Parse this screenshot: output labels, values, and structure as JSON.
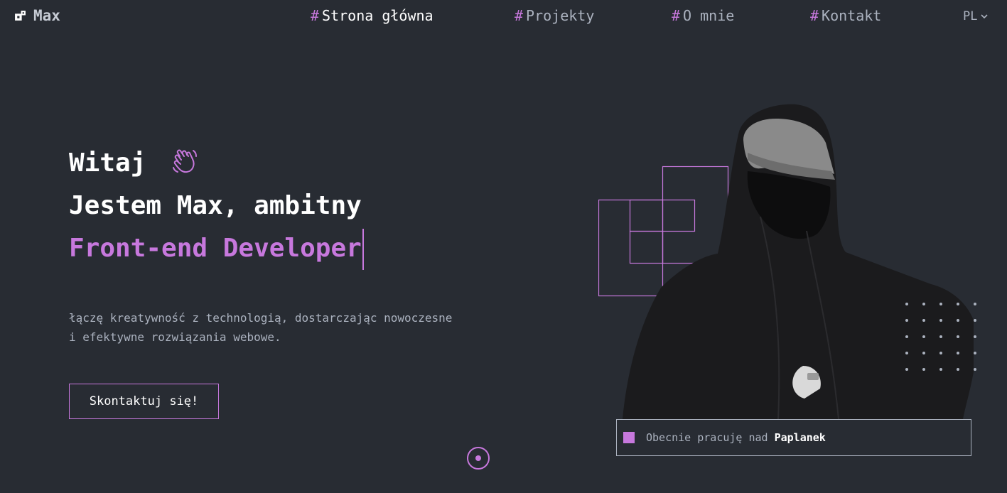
{
  "header": {
    "logo_text": "Max",
    "logo_icon": "logo-icon",
    "nav": [
      {
        "hash": "#",
        "label": "Strona główna",
        "active": true
      },
      {
        "hash": "#",
        "label": "Projekty",
        "active": false
      },
      {
        "hash": "#",
        "label": "O mnie",
        "active": false
      },
      {
        "hash": "#",
        "label": "Kontakt",
        "active": false
      }
    ],
    "language": "PL",
    "language_icon": "chevron-down-icon"
  },
  "hero": {
    "greeting": "Witaj",
    "greeting_icon": "waving-hand-icon",
    "intro": "Jestem Max, ambitny",
    "role": "Front-end Developer",
    "description_line1": "łączę kreatywność z technologią, dostarczając nowoczesne",
    "description_line2": "i efektywne rozwiązania webowe.",
    "cta_label": "Skontaktuj się!"
  },
  "status": {
    "text": "Obecnie pracuję nad",
    "project": "Paplanek"
  },
  "colors": {
    "background": "#282c33",
    "accent": "#c778dd",
    "text": "#abb2bf",
    "heading": "#ffffff"
  }
}
